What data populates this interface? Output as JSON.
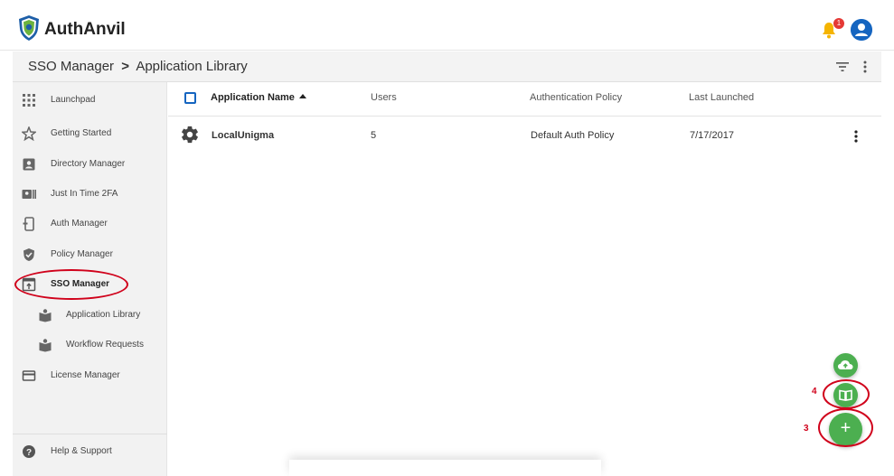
{
  "app": {
    "brand": "AuthAnvil",
    "notification_count": "1"
  },
  "breadcrumb": {
    "parent": "SSO Manager",
    "separator": ">",
    "current": "Application Library"
  },
  "sidebar": {
    "items": [
      {
        "label": "Launchpad",
        "icon": "grid-icon"
      },
      {
        "label": "Getting Started",
        "icon": "star-icon"
      },
      {
        "label": "Directory Manager",
        "icon": "contact-card-icon"
      },
      {
        "label": "Just In Time 2FA",
        "icon": "badge-icon"
      },
      {
        "label": "Auth Manager",
        "icon": "phone-key-icon"
      },
      {
        "label": "Policy Manager",
        "icon": "shield-check-icon"
      },
      {
        "label": "SSO Manager",
        "icon": "window-login-icon"
      },
      {
        "label": "Application Library",
        "icon": "book-stack-icon"
      },
      {
        "label": "Workflow Requests",
        "icon": "book-stack-icon"
      },
      {
        "label": "License Manager",
        "icon": "credit-card-icon"
      }
    ],
    "help_label": "Help & Support"
  },
  "table": {
    "columns": [
      "Application Name",
      "Users",
      "Authentication Policy",
      "Last Launched"
    ],
    "rows": [
      {
        "name": "LocalUnigma",
        "users": "5",
        "policy": "Default Auth Policy",
        "last_launched": "7/17/2017"
      }
    ]
  },
  "fab": {
    "add_label": "+"
  },
  "annotations": {
    "label_4": "4",
    "label_3": "3"
  },
  "colors": {
    "primary": "#1565c0",
    "fab_green": "#4caf50",
    "callout_red": "#d0021b"
  }
}
